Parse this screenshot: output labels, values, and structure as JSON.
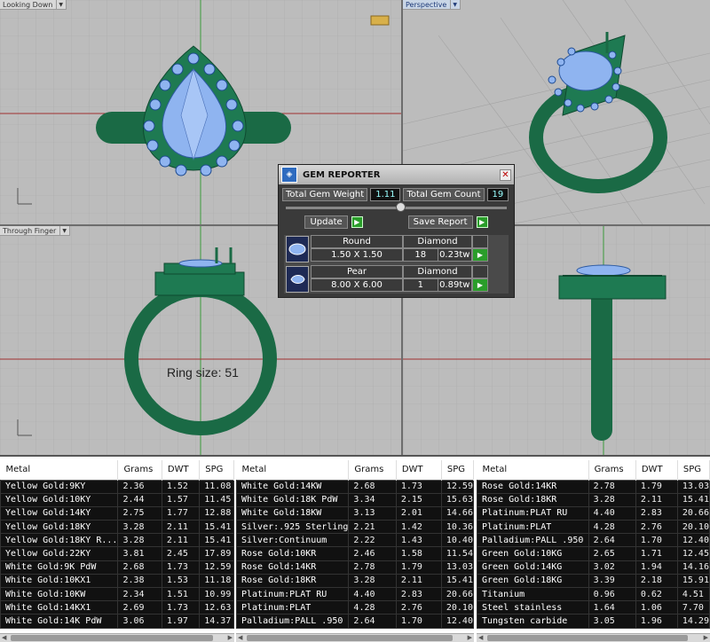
{
  "viewports": {
    "top_left": {
      "label": "Looking Down"
    },
    "top_right": {
      "label": "Perspective"
    },
    "bottom_left": {
      "label": "Through Finger",
      "annotation": "Ring size: 51"
    },
    "bottom_right": {
      "label": ""
    }
  },
  "gem_reporter": {
    "title": "GEM REPORTER",
    "total_weight_label": "Total Gem Weight",
    "total_weight_value": "1.11",
    "total_count_label": "Total Gem Count",
    "total_count_value": "19",
    "update_label": "Update",
    "save_label": "Save Report",
    "gems": [
      {
        "shape": "Round",
        "material": "Diamond",
        "size": "1.50 X 1.50",
        "count": "18",
        "weight": "0.23tw"
      },
      {
        "shape": "Pear",
        "material": "Diamond",
        "size": "8.00 X 6.00",
        "count": "1",
        "weight": "0.89tw"
      }
    ]
  },
  "metal_tables": {
    "headers": [
      "Metal",
      "Grams",
      "DWT",
      "SPG"
    ],
    "table1": [
      [
        "Yellow Gold:9KY",
        "2.36",
        "1.52",
        "11.08"
      ],
      [
        "Yellow Gold:10KY",
        "2.44",
        "1.57",
        "11.45"
      ],
      [
        "Yellow Gold:14KY",
        "2.75",
        "1.77",
        "12.88"
      ],
      [
        "Yellow Gold:18KY",
        "3.28",
        "2.11",
        "15.41"
      ],
      [
        "Yellow Gold:18KY R...",
        "3.28",
        "2.11",
        "15.41"
      ],
      [
        "Yellow Gold:22KY",
        "3.81",
        "2.45",
        "17.89"
      ],
      [
        "White Gold:9K PdW",
        "2.68",
        "1.73",
        "12.59"
      ],
      [
        "White Gold:10KX1",
        "2.38",
        "1.53",
        "11.18"
      ],
      [
        "White Gold:10KW",
        "2.34",
        "1.51",
        "10.99"
      ],
      [
        "White Gold:14KX1",
        "2.69",
        "1.73",
        "12.63"
      ],
      [
        "White Gold:14K PdW",
        "3.06",
        "1.97",
        "14.37"
      ]
    ],
    "table2": [
      [
        "White Gold:14KW",
        "2.68",
        "1.73",
        "12.59"
      ],
      [
        "White Gold:18K PdW",
        "3.34",
        "2.15",
        "15.63"
      ],
      [
        "White Gold:18KW",
        "3.13",
        "2.01",
        "14.66"
      ],
      [
        "Silver:.925 Sterling",
        "2.21",
        "1.42",
        "10.36"
      ],
      [
        "Silver:Continuum",
        "2.22",
        "1.43",
        "10.40"
      ],
      [
        "Rose Gold:10KR",
        "2.46",
        "1.58",
        "11.54"
      ],
      [
        "Rose Gold:14KR",
        "2.78",
        "1.79",
        "13.03"
      ],
      [
        "Rose Gold:18KR",
        "3.28",
        "2.11",
        "15.41"
      ],
      [
        "Platinum:PLAT RU",
        "4.40",
        "2.83",
        "20.66"
      ],
      [
        "Platinum:PLAT",
        "4.28",
        "2.76",
        "20.10"
      ],
      [
        "Palladium:PALL .950",
        "2.64",
        "1.70",
        "12.40"
      ]
    ],
    "table3": [
      [
        "Rose Gold:14KR",
        "2.78",
        "1.79",
        "13.03"
      ],
      [
        "Rose Gold:18KR",
        "3.28",
        "2.11",
        "15.41"
      ],
      [
        "Platinum:PLAT RU",
        "4.40",
        "2.83",
        "20.66"
      ],
      [
        "Platinum:PLAT",
        "4.28",
        "2.76",
        "20.10"
      ],
      [
        "Palladium:PALL .950",
        "2.64",
        "1.70",
        "12.40"
      ],
      [
        "Green Gold:10KG",
        "2.65",
        "1.71",
        "12.45"
      ],
      [
        "Green Gold:14KG",
        "3.02",
        "1.94",
        "14.16"
      ],
      [
        "Green Gold:18KG",
        "3.39",
        "2.18",
        "15.91"
      ],
      [
        "Titanium",
        "0.96",
        "0.62",
        "4.51"
      ],
      [
        "Steel stainless",
        "1.64",
        "1.06",
        "7.70"
      ],
      [
        "Tungsten carbide",
        "3.05",
        "1.96",
        "14.29"
      ]
    ]
  },
  "colors": {
    "metal": "#1e6e4a",
    "gem": "#8fb4f0",
    "viewport": "#bcbcbc"
  }
}
